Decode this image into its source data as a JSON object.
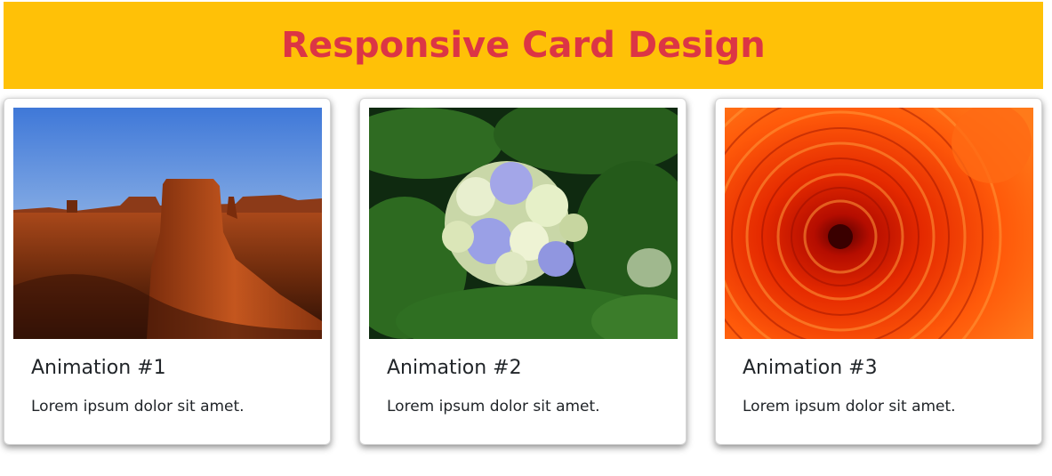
{
  "header": {
    "title": "Responsive Card Design",
    "background_color": "#ffc107",
    "title_color": "#dc3545"
  },
  "cards": [
    {
      "title": "Animation #1",
      "text": "Lorem ipsum dolor sit amet.",
      "image": "desert-butte-landscape"
    },
    {
      "title": "Animation #2",
      "text": "Lorem ipsum dolor sit amet.",
      "image": "hydrangea-flower"
    },
    {
      "title": "Animation #3",
      "text": "Lorem ipsum dolor sit amet.",
      "image": "orange-chrysanthemum"
    }
  ]
}
